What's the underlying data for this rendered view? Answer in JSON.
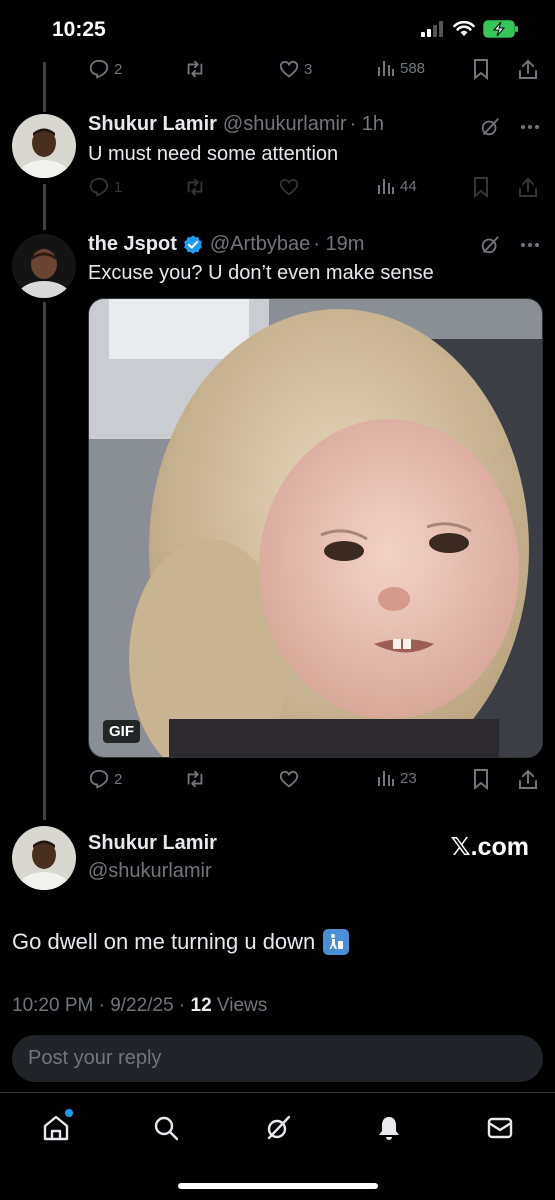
{
  "status_bar": {
    "time": "10:25"
  },
  "previous_post_stats": {
    "replies": "2",
    "likes": "3",
    "views": "588"
  },
  "posts": [
    {
      "name": "Shukur Lamir",
      "handle": "@shukurlamir",
      "time": "· 1h",
      "text": "U must need some attention",
      "stats": {
        "replies": "1",
        "views": "44"
      }
    },
    {
      "name": "the Jspot",
      "verified": true,
      "handle": "@Artbybae",
      "time": "· 19m",
      "text": "Excuse you? U don’t even make sense",
      "media": {
        "type": "gif",
        "badge": "GIF"
      },
      "stats": {
        "replies": "2",
        "views": "23"
      }
    }
  ],
  "main_post": {
    "name": "Shukur Lamir",
    "handle": "@shukurlamir",
    "watermark": "𝕏.com",
    "text": "Go dwell on me turning u down",
    "emoji": "🚮",
    "timestamp": "10:20 PM · 9/22/25 ·",
    "views_count": "12",
    "views_label": "Views"
  },
  "reply": {
    "placeholder": "Post your reply"
  },
  "tabbar": [
    "home-icon",
    "search-icon",
    "grok-icon",
    "notifications-icon",
    "messages-icon"
  ],
  "colors": {
    "accent": "#1d9bf0",
    "muted": "#71767b",
    "text": "#e7e9ea",
    "background": "#000000"
  }
}
